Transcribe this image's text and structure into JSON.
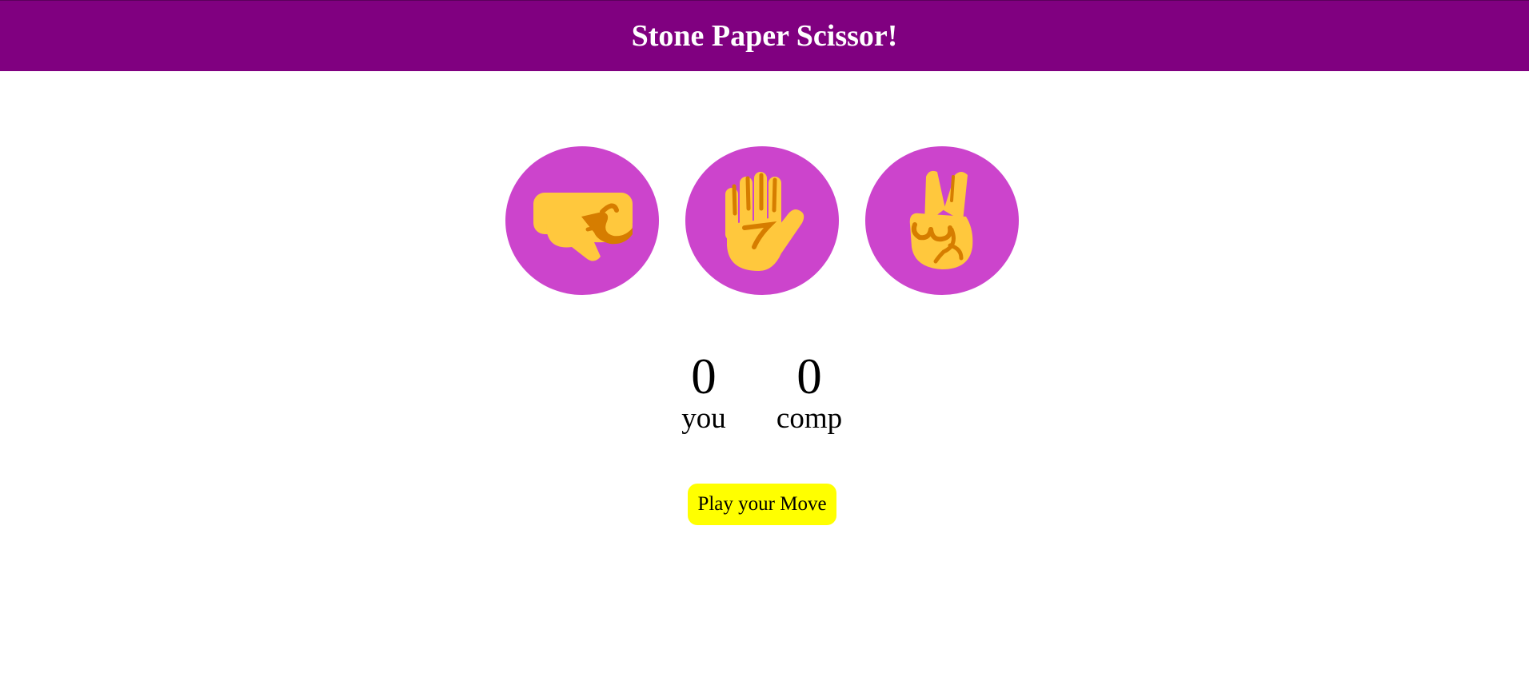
{
  "header": {
    "title": "Stone Paper Scissor!"
  },
  "choices": [
    {
      "id": "stone",
      "icon": "fist-icon"
    },
    {
      "id": "paper",
      "icon": "raised-hand-icon"
    },
    {
      "id": "scissor",
      "icon": "victory-hand-icon"
    }
  ],
  "scoreboard": {
    "user": {
      "score": "0",
      "label": "you"
    },
    "comp": {
      "score": "0",
      "label": "comp"
    }
  },
  "message": {
    "text": "Play your Move"
  },
  "colors": {
    "header_bg": "#800080",
    "choice_bg": "#cc44cc",
    "hand_yellow": "#ffc83d",
    "hand_shade": "#d67d00",
    "message_bg": "#ffff00"
  }
}
